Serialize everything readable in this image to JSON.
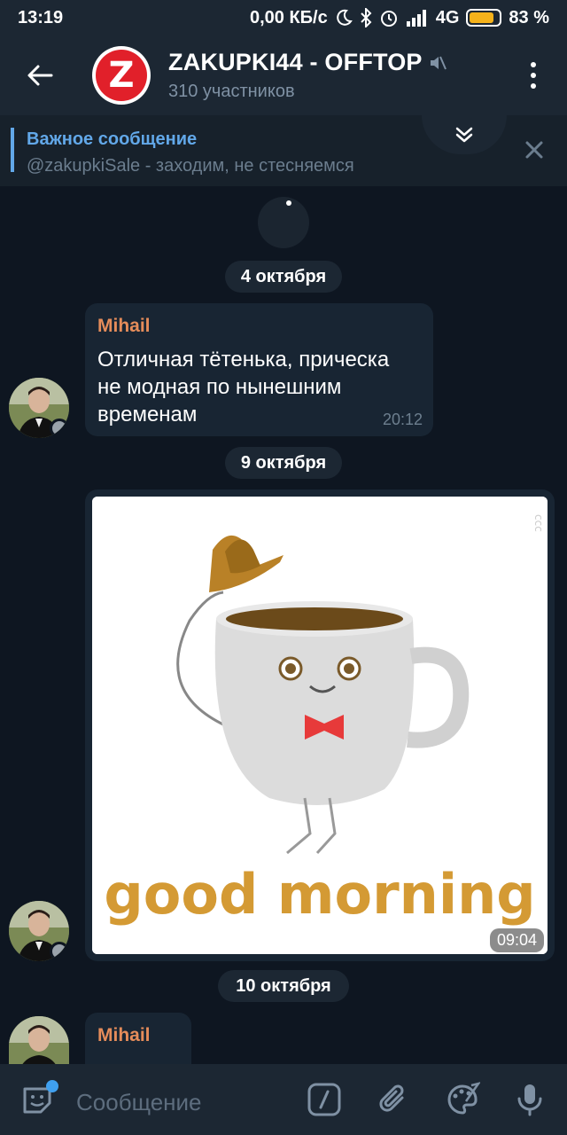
{
  "status_bar": {
    "time": "13:19",
    "net_speed": "0,00 КБ/с",
    "network": "4G",
    "battery_percent": "83 %",
    "battery_level": 0.83,
    "icons": [
      "moon-icon",
      "bluetooth-icon",
      "alarm-icon",
      "signal-icon",
      "battery-icon"
    ]
  },
  "header": {
    "avatar_letter": "Z",
    "title": "ZAKUPKI44 - OFFTOP",
    "subtitle": "310 участников",
    "muted_icon": "muted-speaker-icon"
  },
  "pinned": {
    "title": "Важное сообщение",
    "text": "@zakupkiSale - заходим, не стесняемся"
  },
  "messages": [
    {
      "date": "4 октября"
    },
    {
      "sender": "Mihail",
      "text": "Отличная тётенька, прическа не модная по нынешним временам",
      "time": "20:12"
    },
    {
      "date": "9 октября"
    },
    {
      "media_caption": "good morning",
      "time": "09:04",
      "watermark": "ccc"
    },
    {
      "date": "10 октября"
    },
    {
      "sender": "Mihail"
    }
  ],
  "input": {
    "placeholder": "Сообщение"
  },
  "colors": {
    "background": "#0e1621",
    "header": "#1c2733",
    "bubble": "#182533",
    "accent": "#62a8e9",
    "sender_name": "#e58c5a",
    "logo_red": "#e1202a"
  }
}
